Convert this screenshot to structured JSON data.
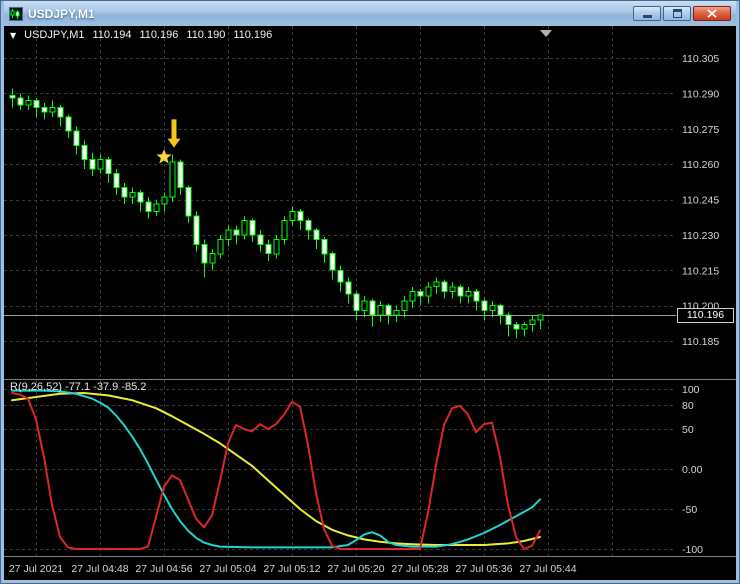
{
  "window": {
    "title": "USDJPY,M1"
  },
  "header": {
    "dropdown_glyph": "▼",
    "symbol": "USDJPY,M1",
    "open": "110.194",
    "high": "110.196",
    "low": "110.190",
    "close": "110.196"
  },
  "colors": {
    "background": "#000000",
    "axis_text": "#d4d4d4",
    "grid": "#3a3a3a",
    "divider": "#7d7d7d",
    "bar": "#00ff00",
    "bull_fill": "#000000",
    "bear_fill": "#ffffff",
    "price_line": "#9c9c9c",
    "shift_marker": "#b4b4b4",
    "indicator_red": "#dd2626",
    "indicator_cyan": "#22d3d3",
    "indicator_yellow": "#ecec33",
    "annotation_arrow": "#f5c518",
    "annotation_star": "#f8d83a"
  },
  "chart_data": [
    {
      "type": "candlestick",
      "symbol": "USDJPY",
      "timeframe": "M1",
      "current_price": "110.196",
      "y_axis": {
        "min": 110.185,
        "max": 110.305,
        "step": 0.015,
        "labels": [
          "110.305",
          "110.290",
          "110.275",
          "110.260",
          "110.245",
          "110.230",
          "110.215",
          "110.200",
          "110.185"
        ]
      },
      "x_axis": {
        "tick_labels": [
          "27 Jul 2021",
          "27 Jul 04:48",
          "27 Jul 04:56",
          "27 Jul 05:04",
          "27 Jul 05:12",
          "27 Jul 05:20",
          "27 Jul 05:28",
          "27 Jul 05:36",
          "27 Jul 05:44"
        ],
        "tick_indices": [
          3,
          11,
          19,
          27,
          35,
          43,
          51,
          59,
          67
        ],
        "grid_only_indices": [
          75
        ]
      },
      "annotations": [
        {
          "type": "arrow-down",
          "index": 20,
          "offset_x": 2,
          "price_tail": 110.279,
          "price_tip": 110.267
        },
        {
          "type": "star",
          "index": 20,
          "offset_x": -8,
          "price": 110.263
        }
      ],
      "ohlc": [
        [
          110.289,
          110.292,
          110.284,
          110.288
        ],
        [
          110.288,
          110.29,
          110.283,
          110.285
        ],
        [
          110.285,
          110.289,
          110.283,
          110.287
        ],
        [
          110.287,
          110.288,
          110.28,
          110.284
        ],
        [
          110.284,
          110.286,
          110.279,
          110.282
        ],
        [
          110.282,
          110.287,
          110.28,
          110.284
        ],
        [
          110.284,
          110.285,
          110.276,
          110.28
        ],
        [
          110.28,
          110.281,
          110.271,
          110.274
        ],
        [
          110.274,
          110.276,
          110.264,
          110.268
        ],
        [
          110.268,
          110.27,
          110.258,
          110.262
        ],
        [
          110.262,
          110.265,
          110.255,
          110.258
        ],
        [
          110.258,
          110.264,
          110.256,
          110.262
        ],
        [
          110.262,
          110.263,
          110.252,
          110.256
        ],
        [
          110.256,
          110.258,
          110.247,
          110.25
        ],
        [
          110.25,
          110.252,
          110.243,
          110.246
        ],
        [
          110.246,
          110.25,
          110.243,
          110.248
        ],
        [
          110.248,
          110.249,
          110.24,
          110.244
        ],
        [
          110.244,
          110.246,
          110.237,
          110.24
        ],
        [
          110.24,
          110.245,
          110.238,
          110.243
        ],
        [
          110.243,
          110.248,
          110.24,
          110.246
        ],
        [
          110.246,
          110.264,
          110.244,
          110.261
        ],
        [
          110.261,
          110.262,
          110.247,
          110.25
        ],
        [
          110.25,
          110.251,
          110.235,
          110.238
        ],
        [
          110.238,
          110.24,
          110.223,
          110.226
        ],
        [
          110.226,
          110.228,
          110.212,
          110.218
        ],
        [
          110.218,
          110.224,
          110.215,
          110.222
        ],
        [
          110.222,
          110.23,
          110.22,
          110.228
        ],
        [
          110.228,
          110.234,
          110.225,
          110.232
        ],
        [
          110.232,
          110.234,
          110.226,
          110.23
        ],
        [
          110.23,
          110.238,
          110.228,
          110.236
        ],
        [
          110.236,
          110.237,
          110.227,
          110.23
        ],
        [
          110.23,
          110.232,
          110.223,
          110.226
        ],
        [
          110.226,
          110.228,
          110.219,
          110.222
        ],
        [
          110.222,
          110.23,
          110.22,
          110.228
        ],
        [
          110.228,
          110.238,
          110.226,
          110.236
        ],
        [
          110.236,
          110.242,
          110.234,
          110.24
        ],
        [
          110.24,
          110.241,
          110.232,
          110.236
        ],
        [
          110.236,
          110.237,
          110.228,
          110.232
        ],
        [
          110.232,
          110.233,
          110.224,
          110.228
        ],
        [
          110.228,
          110.229,
          110.218,
          110.222
        ],
        [
          110.222,
          110.223,
          110.211,
          110.215
        ],
        [
          110.215,
          110.217,
          110.206,
          110.21
        ],
        [
          110.21,
          110.212,
          110.201,
          110.205
        ],
        [
          110.205,
          110.206,
          110.194,
          110.198
        ],
        [
          110.198,
          110.204,
          110.195,
          110.202
        ],
        [
          110.202,
          110.203,
          110.191,
          110.196
        ],
        [
          110.196,
          110.202,
          110.193,
          110.2
        ],
        [
          110.2,
          110.201,
          110.192,
          110.196
        ],
        [
          110.196,
          110.2,
          110.193,
          110.198
        ],
        [
          110.198,
          110.204,
          110.195,
          110.202
        ],
        [
          110.202,
          110.208,
          110.199,
          110.206
        ],
        [
          110.206,
          110.207,
          110.2,
          110.204
        ],
        [
          110.204,
          110.21,
          110.201,
          110.208
        ],
        [
          110.208,
          110.212,
          110.205,
          110.21
        ],
        [
          110.21,
          110.211,
          110.203,
          110.206
        ],
        [
          110.206,
          110.21,
          110.203,
          110.208
        ],
        [
          110.208,
          110.209,
          110.201,
          110.204
        ],
        [
          110.204,
          110.208,
          110.201,
          110.206
        ],
        [
          110.206,
          110.207,
          110.198,
          110.202
        ],
        [
          110.202,
          110.203,
          110.194,
          110.198
        ],
        [
          110.198,
          110.202,
          110.195,
          110.2
        ],
        [
          110.2,
          110.201,
          110.192,
          110.196
        ],
        [
          110.196,
          110.197,
          110.187,
          110.192
        ],
        [
          110.192,
          110.193,
          110.186,
          110.19
        ],
        [
          110.19,
          110.193,
          110.187,
          110.192
        ],
        [
          110.192,
          110.196,
          110.189,
          110.194
        ],
        [
          110.194,
          110.196,
          110.19,
          110.196
        ]
      ]
    },
    {
      "type": "line",
      "title": "R(9,26,52) -77.1 -37.9 -85.2",
      "y_axis": {
        "labels": [
          "100",
          "80",
          "50",
          "0.00",
          "-50",
          "-100"
        ],
        "values": [
          100,
          80,
          50,
          0,
          -50,
          -100
        ]
      },
      "series": [
        {
          "name": "yellow",
          "color": "#ecec33",
          "points": [
            [
              0,
              86
            ],
            [
              3,
              90
            ],
            [
              6,
              94
            ],
            [
              9,
              95
            ],
            [
              12,
              92
            ],
            [
              15,
              86
            ],
            [
              18,
              76
            ],
            [
              20,
              66
            ],
            [
              22,
              55
            ],
            [
              24,
              44
            ],
            [
              26,
              32
            ],
            [
              28,
              18
            ],
            [
              30,
              4
            ],
            [
              32,
              -14
            ],
            [
              34,
              -32
            ],
            [
              36,
              -50
            ],
            [
              38,
              -65
            ],
            [
              40,
              -76
            ],
            [
              42,
              -83
            ],
            [
              44,
              -88
            ],
            [
              46,
              -91
            ],
            [
              48,
              -93
            ],
            [
              50,
              -94
            ],
            [
              53,
              -95
            ],
            [
              56,
              -95
            ],
            [
              59,
              -95
            ],
            [
              62,
              -93
            ],
            [
              64,
              -90
            ],
            [
              66,
              -85
            ]
          ]
        },
        {
          "name": "cyan",
          "color": "#22d3d3",
          "points": [
            [
              0,
              98
            ],
            [
              4,
              98
            ],
            [
              6,
              97
            ],
            [
              8,
              94
            ],
            [
              10,
              88
            ],
            [
              11,
              83
            ],
            [
              12,
              77
            ],
            [
              13,
              67
            ],
            [
              14,
              55
            ],
            [
              15,
              41
            ],
            [
              16,
              25
            ],
            [
              17,
              7
            ],
            [
              18,
              -13
            ],
            [
              19,
              -32
            ],
            [
              20,
              -50
            ],
            [
              21,
              -65
            ],
            [
              22,
              -77
            ],
            [
              23,
              -86
            ],
            [
              24,
              -92
            ],
            [
              25,
              -95
            ],
            [
              26,
              -97
            ],
            [
              30,
              -98
            ],
            [
              40,
              -98
            ],
            [
              42,
              -95
            ],
            [
              43,
              -89
            ],
            [
              44,
              -82
            ],
            [
              45,
              -79
            ],
            [
              46,
              -83
            ],
            [
              47,
              -91
            ],
            [
              48,
              -95
            ],
            [
              50,
              -97
            ],
            [
              53,
              -97
            ],
            [
              55,
              -94
            ],
            [
              57,
              -88
            ],
            [
              59,
              -80
            ],
            [
              61,
              -70
            ],
            [
              63,
              -59
            ],
            [
              65,
              -48
            ],
            [
              66,
              -38
            ]
          ]
        },
        {
          "name": "red",
          "color": "#dd2626",
          "points": [
            [
              0,
              95
            ],
            [
              1,
              93
            ],
            [
              2,
              88
            ],
            [
              3,
              62
            ],
            [
              4,
              15
            ],
            [
              5,
              -45
            ],
            [
              6,
              -85
            ],
            [
              7,
              -98
            ],
            [
              8,
              -100
            ],
            [
              16,
              -100
            ],
            [
              17,
              -97
            ],
            [
              18,
              -60
            ],
            [
              19,
              -22
            ],
            [
              20,
              -8
            ],
            [
              21,
              -14
            ],
            [
              22,
              -38
            ],
            [
              23,
              -62
            ],
            [
              24,
              -73
            ],
            [
              25,
              -58
            ],
            [
              26,
              -15
            ],
            [
              27,
              32
            ],
            [
              28,
              55
            ],
            [
              29,
              50
            ],
            [
              30,
              47
            ],
            [
              31,
              56
            ],
            [
              32,
              50
            ],
            [
              33,
              56
            ],
            [
              34,
              68
            ],
            [
              35,
              84
            ],
            [
              36,
              78
            ],
            [
              37,
              30
            ],
            [
              38,
              -30
            ],
            [
              39,
              -75
            ],
            [
              40,
              -96
            ],
            [
              41,
              -100
            ],
            [
              51,
              -100
            ],
            [
              52,
              -55
            ],
            [
              53,
              5
            ],
            [
              54,
              55
            ],
            [
              55,
              76
            ],
            [
              56,
              79
            ],
            [
              57,
              68
            ],
            [
              58,
              46
            ],
            [
              59,
              56
            ],
            [
              60,
              58
            ],
            [
              61,
              15
            ],
            [
              62,
              -45
            ],
            [
              63,
              -85
            ],
            [
              64,
              -100
            ],
            [
              65,
              -96
            ],
            [
              66,
              -77
            ]
          ]
        }
      ]
    }
  ]
}
